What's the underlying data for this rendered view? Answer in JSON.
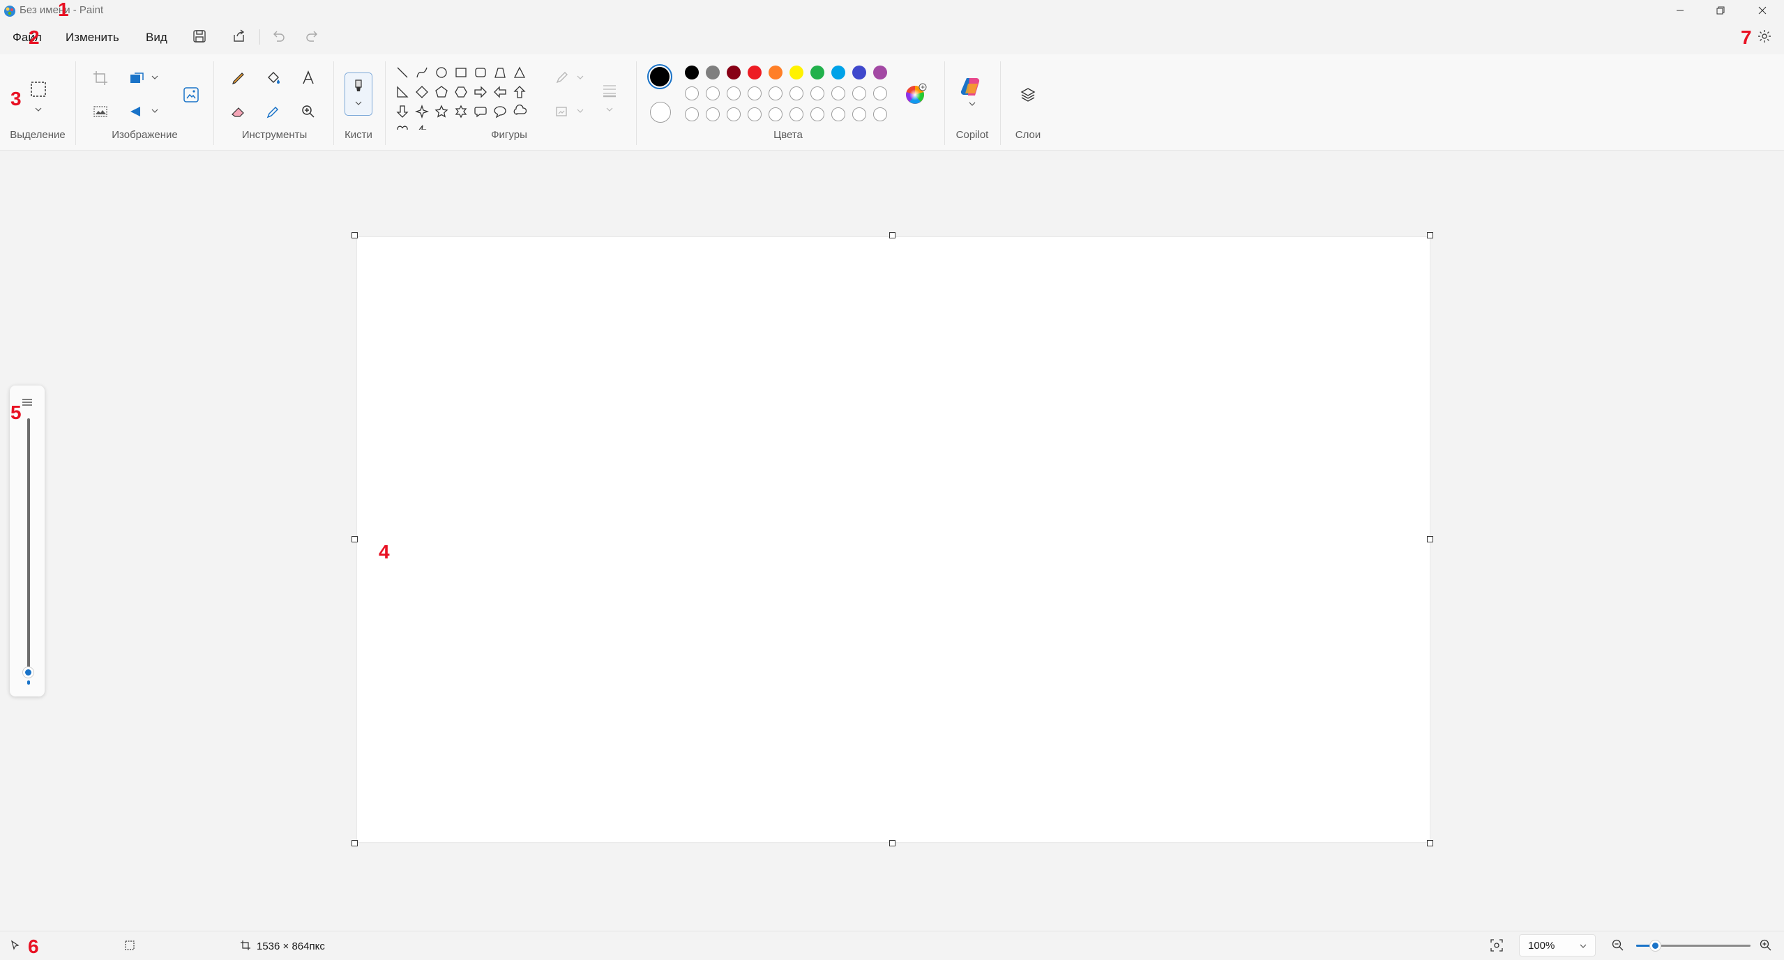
{
  "window": {
    "title": "Без имени - Paint"
  },
  "menu": {
    "file": "Файл",
    "edit": "Изменить",
    "view": "Вид"
  },
  "ribbon": {
    "groups": {
      "selection": "Выделение",
      "image": "Изображение",
      "tools": "Инструменты",
      "brushes": "Кисти",
      "shapes": "Фигуры",
      "colors": "Цвета",
      "copilot": "Copilot",
      "layers": "Слои"
    },
    "palette_row1": [
      "#000000",
      "#7f7f7f",
      "#880015",
      "#ed1c24",
      "#ff7f27",
      "#fff200",
      "#22b14c",
      "#00a2e8",
      "#3f48cc",
      "#a349a4"
    ],
    "palette_row2": [
      "#ffffff",
      "#c3c3c3",
      "#b97a57",
      "#ffaec9",
      "#ffc90e",
      "#efe4b0",
      "#b5e61d",
      "#99d9ea",
      "#7092be",
      "#c8bfe7"
    ],
    "primary_color": "#000000",
    "secondary_color": "#ffffff"
  },
  "status": {
    "canvas_size": "1536 × 864пкс",
    "zoom": "100%"
  },
  "markers": {
    "m1": "1",
    "m2": "2",
    "m3": "3",
    "m4": "4",
    "m5": "5",
    "m6": "6",
    "m7": "7"
  }
}
